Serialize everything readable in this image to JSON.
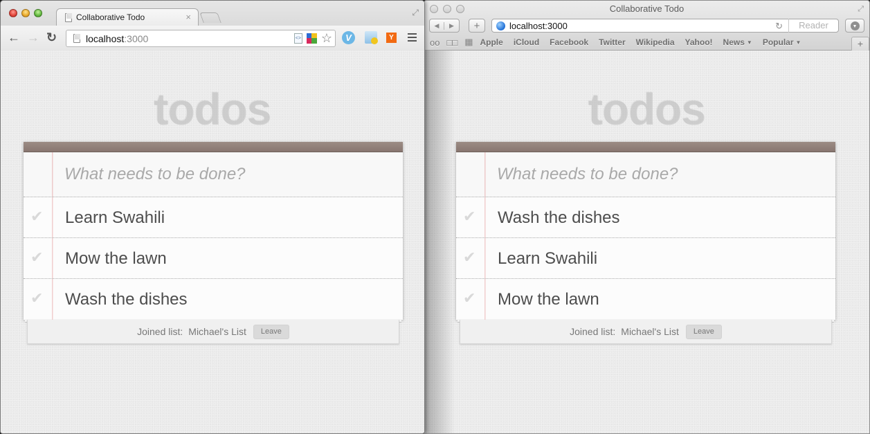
{
  "chrome_window": {
    "tab_title": "Collaborative Todo",
    "tab_close": "×",
    "address": {
      "host": "localhost",
      "port": ":3000"
    },
    "icons": {
      "back": "←",
      "forward": "→",
      "reload": "↻",
      "star": "☆",
      "doc": "<>",
      "ext_v": "V",
      "ext_y": "Y",
      "fullscreen": "⤢"
    },
    "app": {
      "title": "todos",
      "input_placeholder": "What needs to be done?",
      "items": [
        {
          "label": "Learn Swahili",
          "check": "✔"
        },
        {
          "label": "Mow the lawn",
          "check": "✔"
        },
        {
          "label": "Wash the dishes",
          "check": "✔"
        }
      ],
      "footer": {
        "joined_label": "Joined list:",
        "list_name": "Michael's List",
        "leave_label": "Leave"
      }
    }
  },
  "safari_window": {
    "window_title": "Collaborative Todo",
    "address": "localhost:3000",
    "reader_label": "Reader",
    "icons": {
      "back": "◀",
      "forward": "▶",
      "add": "+",
      "reload": "↻",
      "reading_list": "oo",
      "bookmarks": "📖",
      "top_sites": "▦",
      "new_tab": "+",
      "fullscreen": "⤢"
    },
    "bookmarks": [
      {
        "label": "Apple",
        "menu": false
      },
      {
        "label": "iCloud",
        "menu": false
      },
      {
        "label": "Facebook",
        "menu": false
      },
      {
        "label": "Twitter",
        "menu": false
      },
      {
        "label": "Wikipedia",
        "menu": false
      },
      {
        "label": "Yahoo!",
        "menu": false
      },
      {
        "label": "News",
        "menu": true
      },
      {
        "label": "Popular",
        "menu": true
      }
    ],
    "dropdown_arrow": "▼",
    "app": {
      "title": "todos",
      "input_placeholder": "What needs to be done?",
      "items": [
        {
          "label": "Wash the dishes",
          "check": "✔"
        },
        {
          "label": "Learn Swahili",
          "check": "✔"
        },
        {
          "label": "Mow the lawn",
          "check": "✔"
        }
      ],
      "footer": {
        "joined_label": "Joined list:",
        "list_name": "Michael's List",
        "leave_label": "Leave"
      }
    }
  }
}
